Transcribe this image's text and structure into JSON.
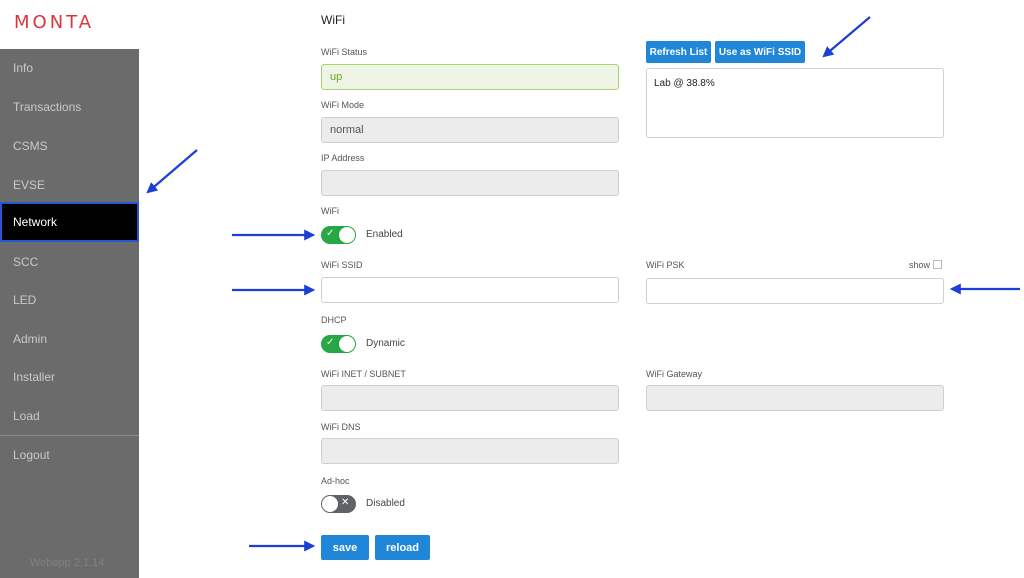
{
  "brand": "MONTA",
  "sidebar": {
    "items": [
      {
        "label": "Info"
      },
      {
        "label": "Transactions"
      },
      {
        "label": "CSMS"
      },
      {
        "label": "EVSE"
      },
      {
        "label": "Network"
      },
      {
        "label": "SCC"
      },
      {
        "label": "LED"
      },
      {
        "label": "Admin"
      },
      {
        "label": "Installer"
      },
      {
        "label": "Load"
      },
      {
        "label": "Logout"
      }
    ],
    "active": "Network",
    "version": "Webapp 2.1.14"
  },
  "form": {
    "title": "WiFi",
    "wifi_status": {
      "label": "WiFi Status",
      "value": "up"
    },
    "wifi_mode": {
      "label": "WiFi Mode",
      "value": "normal"
    },
    "ip_address": {
      "label": "IP Address",
      "value": ""
    },
    "wifi": {
      "label": "WiFi",
      "state": "Enabled"
    },
    "wifi_ssid": {
      "label": "WiFi SSID",
      "value": ""
    },
    "wifi_psk": {
      "label": "WiFi PSK",
      "value": "",
      "show_label": "show"
    },
    "dhcp": {
      "label": "DHCP",
      "state": "Dynamic"
    },
    "wifi_inet": {
      "label": "WiFi INET / SUBNET",
      "value": ""
    },
    "wifi_gateway": {
      "label": "WiFi Gateway",
      "value": ""
    },
    "wifi_dns": {
      "label": "WiFi DNS",
      "value": ""
    },
    "adhoc": {
      "label": "Ad-hoc",
      "state": "Disabled"
    },
    "refresh_list_label": "Refresh List",
    "use_as_ssid_label": "Use as WiFi SSID",
    "network_list": [
      "Lab @ 38.8%"
    ],
    "save_label": "save",
    "reload_label": "reload"
  },
  "colors": {
    "brand": "#d9363e",
    "sidebar_bg": "#6b6b6b",
    "active_border": "#2756d4",
    "button": "#1f86d8",
    "toggle_on": "#27a844",
    "toggle_off": "#5f6368",
    "annotation_arrow": "#1c3fd6"
  }
}
